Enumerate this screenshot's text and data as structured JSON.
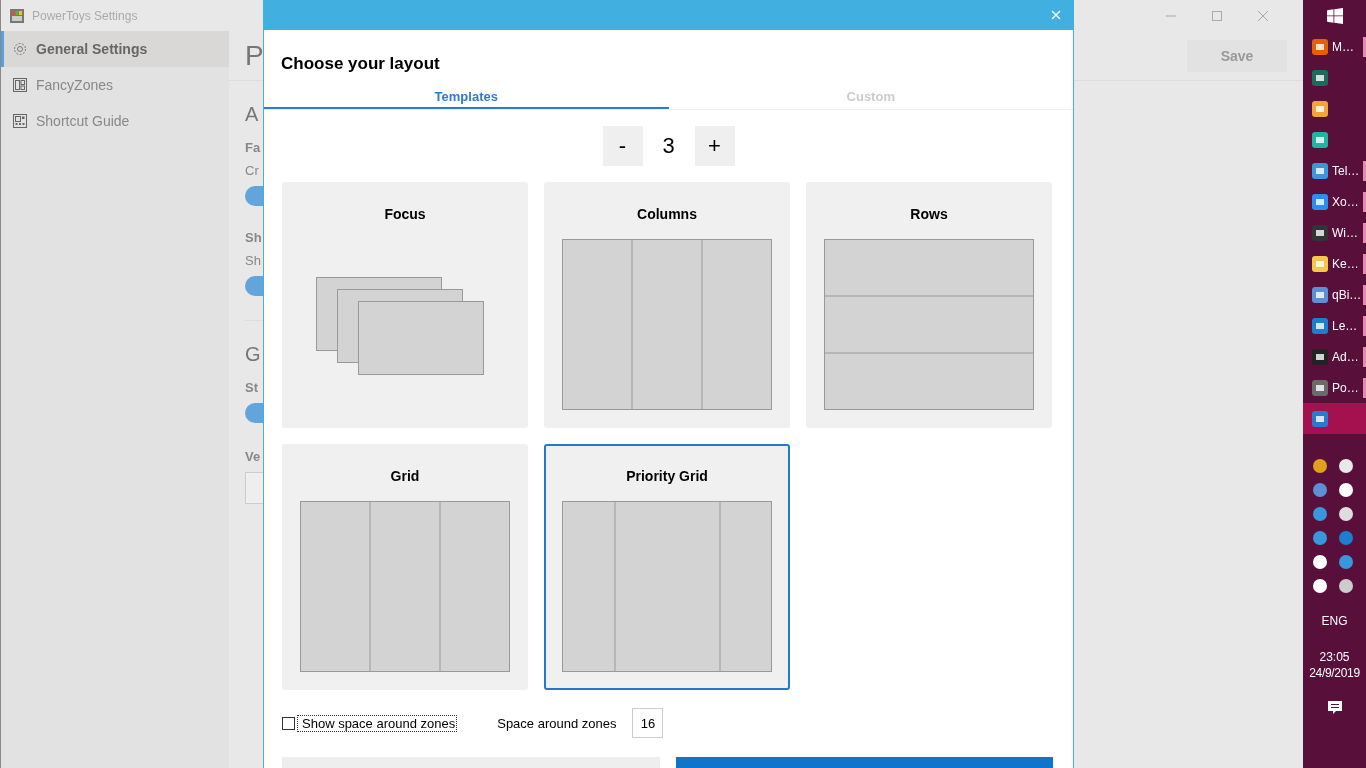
{
  "settings_window": {
    "title": "PowerToys Settings",
    "save_button": {
      "label": "Save",
      "disabled": true
    },
    "sidebar": {
      "items": [
        {
          "label": "General Settings",
          "selected": true
        },
        {
          "label": "FancyZones",
          "selected": false
        },
        {
          "label": "Shortcut Guide",
          "selected": false
        }
      ]
    },
    "page_title": "P",
    "sections": [
      {
        "heading": "A",
        "settings": [
          {
            "label": "Fa",
            "description": "Cr",
            "on": true
          },
          {
            "label": "Sh",
            "description": "Sh",
            "on": true
          }
        ]
      },
      {
        "heading": "G",
        "settings": [
          {
            "label": "St",
            "on": true
          }
        ]
      }
    ],
    "version_label": "Ve"
  },
  "dialog": {
    "title": "Choose your layout",
    "tabs": [
      {
        "label": "Templates",
        "selected": true
      },
      {
        "label": "Custom",
        "selected": false
      }
    ],
    "zone_count": {
      "decrement": "-",
      "value": "3",
      "increment": "+"
    },
    "templates": [
      {
        "name": "Focus",
        "kind": "focus",
        "selected": false
      },
      {
        "name": "Columns",
        "kind": "columns",
        "selected": false
      },
      {
        "name": "Rows",
        "kind": "rows",
        "selected": false
      },
      {
        "name": "Grid",
        "kind": "grid",
        "selected": false
      },
      {
        "name": "Priority Grid",
        "kind": "priority-grid",
        "selected": true
      }
    ],
    "show_space": {
      "label": "Show space around zones",
      "checked": false
    },
    "space_around": {
      "label": "Space around zones",
      "value": "16"
    }
  },
  "taskbar": {
    "items": [
      {
        "label": "M…",
        "open": true,
        "selected": false
      },
      {
        "open": false,
        "selected": false
      },
      {
        "open": false,
        "selected": false
      },
      {
        "open": false,
        "selected": false
      },
      {
        "label": "Tel…",
        "open": true,
        "selected": false
      },
      {
        "label": "Xo…",
        "open": true,
        "selected": false
      },
      {
        "label": "Wi…",
        "open": true,
        "selected": false
      },
      {
        "label": "Ke…",
        "open": true,
        "selected": false
      },
      {
        "label": "qBi…",
        "open": true,
        "selected": false
      },
      {
        "label": "Le…",
        "open": true,
        "selected": false
      },
      {
        "label": "Ad…",
        "open": true,
        "selected": false
      },
      {
        "label": "Po…",
        "open": true,
        "selected": false
      },
      {
        "open": false,
        "selected": true
      }
    ],
    "language": "ENG",
    "time": "23:05",
    "date": "24/9/2019"
  }
}
